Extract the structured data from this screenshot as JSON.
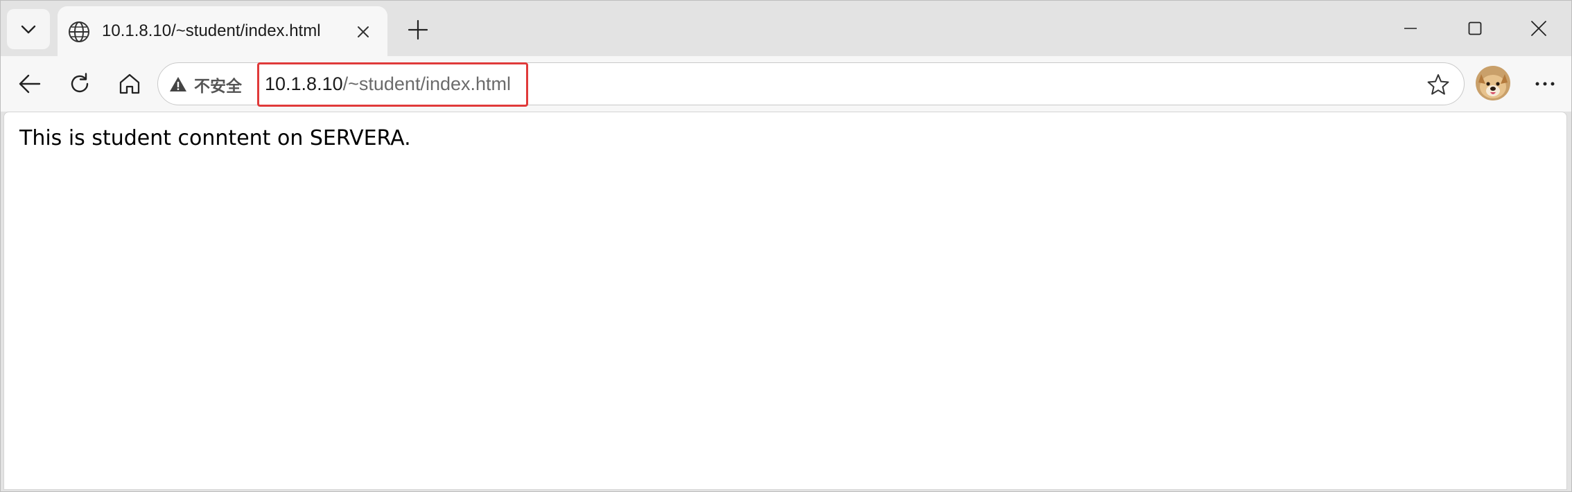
{
  "tab": {
    "title": "10.1.8.10/~student/index.html"
  },
  "toolbar": {
    "security_label": "不安全",
    "url_host": "10.1.8.10",
    "url_path": "/~student/index.html"
  },
  "page": {
    "body_text": "This is student conntent on SERVERA."
  },
  "icons": {
    "tab_list": "chevron-down-icon",
    "tab_favicon": "globe-icon",
    "tab_close": "close-icon",
    "new_tab": "plus-icon",
    "minimize": "minimize-icon",
    "maximize": "maximize-icon",
    "close_window": "close-icon",
    "back": "arrow-left-icon",
    "reload": "reload-icon",
    "home": "home-icon",
    "security": "warning-icon",
    "favorite": "star-icon",
    "profile": "avatar",
    "menu": "more-icon"
  },
  "colors": {
    "highlight_box": "#e03a3a",
    "tabstrip_bg": "#e3e3e3",
    "toolbar_bg": "#f7f7f7"
  }
}
